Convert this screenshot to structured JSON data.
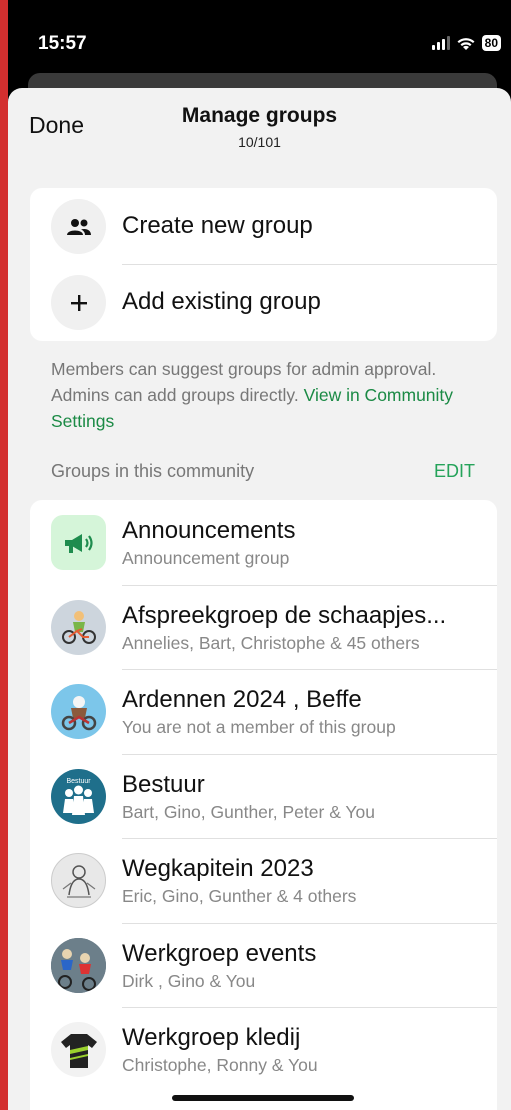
{
  "status_bar": {
    "time": "15:57",
    "battery": "80"
  },
  "header": {
    "done_label": "Done",
    "title": "Manage groups",
    "subtitle": "10/101"
  },
  "actions": [
    {
      "label": "Create new group",
      "icon": "group-icon"
    },
    {
      "label": "Add existing group",
      "icon": "plus-icon"
    }
  ],
  "info": {
    "text": "Members can suggest groups for admin approval. Admins can add groups directly. ",
    "link": "View in Community Settings"
  },
  "section": {
    "header": "Groups in this community",
    "edit_label": "EDIT"
  },
  "groups": [
    {
      "name": "Announcements",
      "subtitle": "Announcement group",
      "icon": "megaphone-icon"
    },
    {
      "name": "Afspreekgroep de schaapjes...",
      "subtitle": "Annelies, Bart, Christophe & 45 others",
      "icon": "cyclist-icon"
    },
    {
      "name": "Ardennen 2024 , Beffe",
      "subtitle": "You are not a member of this group",
      "icon": "bike-photo-icon"
    },
    {
      "name": "Bestuur",
      "subtitle": "Bart, Gino, Gunther, Peter & You",
      "icon": "bestuur-logo-icon",
      "avatar_text": "Bestuur"
    },
    {
      "name": "Wegkapitein 2023",
      "subtitle": "Eric, Gino, Gunther & 4 others",
      "icon": "sketch-photo-icon"
    },
    {
      "name": "Werkgroep events",
      "subtitle": "Dirk , Gino & You",
      "icon": "cycling-race-photo-icon"
    },
    {
      "name": "Werkgroep kledij",
      "subtitle": "Christophe, Ronny & You",
      "icon": "jersey-photo-icon"
    }
  ],
  "colors": {
    "accent_green": "#25a35a",
    "link_green": "#1b8a45",
    "sheet_bg": "#f2f2f2"
  }
}
